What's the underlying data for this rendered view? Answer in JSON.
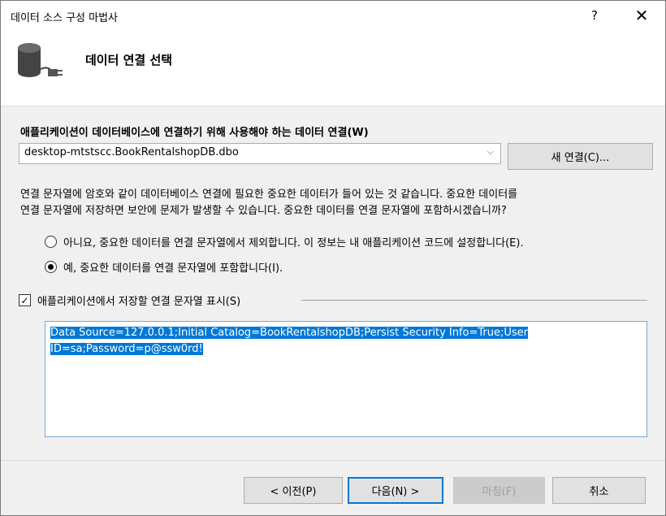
{
  "window": {
    "title": "데이터 소스 구성 마법사",
    "help_label": "?",
    "close_label": "✕"
  },
  "header": {
    "title": "데이터 연결 선택",
    "icon": "database-plug-icon"
  },
  "connection": {
    "label": "애플리케이션이 데이터베이스에 연결하기 위해 사용해야 하는 데이터 연결(W)",
    "selected": "desktop-mtstscc.BookRentalshopDB.dbo",
    "new_button": "새 연결(C)..."
  },
  "sensitive": {
    "line1": "연결 문자열에 암호와 같이 데이터베이스 연결에 필요한 중요한 데이터가 들어 있는 것 같습니다. 중요한 데이터를",
    "line2": "연결 문자열에 저장하면 보안에 문제가 발생할 수 있습니다. 중요한 데이터를 연결 문자열에 포함하시겠습니까?",
    "option_exclude": "아니요, 중요한 데이터를 연결 문자열에서 제외합니다. 이 정보는 내 애플리케이션 코드에 설정합니다(E).",
    "option_include": "예, 중요한 데이터를 연결 문자열에 포함합니다(I).",
    "selected_option": "include"
  },
  "show_string": {
    "label": "애플리케이션에서 저장할 연결 문자열 표시(S)",
    "checked": true
  },
  "connection_string": {
    "line1": "Data Source=127.0.0.1;Initial Catalog=BookRentalshopDB;Persist Security Info=True;User",
    "line2": "ID=sa;Password=p@ssw0rd!"
  },
  "footer": {
    "prev": "< 이전(P)",
    "next": "다음(N) >",
    "finish": "마침(F)",
    "cancel": "취소"
  },
  "colors": {
    "accent": "#0078d7",
    "selection": "#0078d7"
  }
}
